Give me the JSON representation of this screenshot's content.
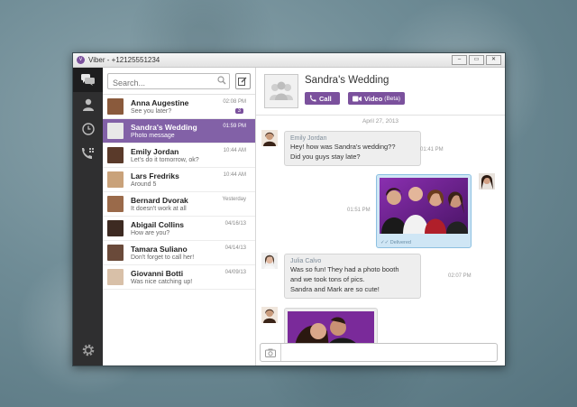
{
  "window": {
    "title": "Viber - +12125551234",
    "logo_glyph": "v",
    "controls": [
      "–",
      "▭",
      "✕"
    ]
  },
  "rail": {
    "icons": [
      "chat-bubbles-icon",
      "contacts-icon",
      "recents-icon",
      "dialpad-icon",
      "settings-gear-icon"
    ]
  },
  "search": {
    "placeholder": "Search..."
  },
  "chats": [
    {
      "name": "Anna Augestine",
      "message": "See you later?",
      "time": "02:08 PM",
      "badge": "3",
      "avatar_color": "#8a5a3c"
    },
    {
      "name": "Sandra's Wedding",
      "message": "Photo message",
      "time": "01:59 PM",
      "active": true,
      "avatar_color": "#e8e8e8"
    },
    {
      "name": "Emily Jordan",
      "message": "Let's do it tomorrow, ok?",
      "time": "10:44 AM",
      "avatar_color": "#5a3a2a"
    },
    {
      "name": "Lars Fredriks",
      "message": "Around 5",
      "time": "10:44 AM",
      "avatar_color": "#c9a27a"
    },
    {
      "name": "Bernard Dvorak",
      "message": "It doesn't work at all",
      "time": "Yesterday",
      "avatar_color": "#9a6a4a"
    },
    {
      "name": "Abigail Collins",
      "message": "How are you?",
      "time": "04/16/13",
      "avatar_color": "#3d2a22"
    },
    {
      "name": "Tamara Suliano",
      "message": "Don't forget to call her!",
      "time": "04/14/13",
      "avatar_color": "#6a4a3a"
    },
    {
      "name": "Giovanni Botti",
      "message": "Was nice catching up!",
      "time": "04/09/13",
      "avatar_color": "#d8c0a8"
    }
  ],
  "conversation": {
    "title": "Sandra's Wedding",
    "call_label": "Call",
    "video_label": "Video",
    "video_sub": "(Beta)",
    "date_separator": "April 27, 2013",
    "messages": [
      {
        "sender": "Emily Jordan",
        "lines": [
          "Hey! how was Sandra's wedding??",
          "Did you guys stay late?"
        ],
        "time": "01:41 PM"
      },
      {
        "outgoing": true,
        "type": "photo",
        "time": "01:51 PM",
        "status": "Delivered"
      },
      {
        "sender": "Julia Calvo",
        "lines": [
          "Was so fun! They had a photo booth",
          "and we took tons of pics.",
          "Sandra and Mark are so cute!"
        ],
        "time": "02:07 PM"
      },
      {
        "type": "photo",
        "partial": true
      }
    ]
  },
  "composer": {
    "placeholder": ""
  },
  "colors": {
    "accent": "#7b519d",
    "rail": "#2f2f30",
    "outgoing_bubble": "#cfe6f5"
  }
}
